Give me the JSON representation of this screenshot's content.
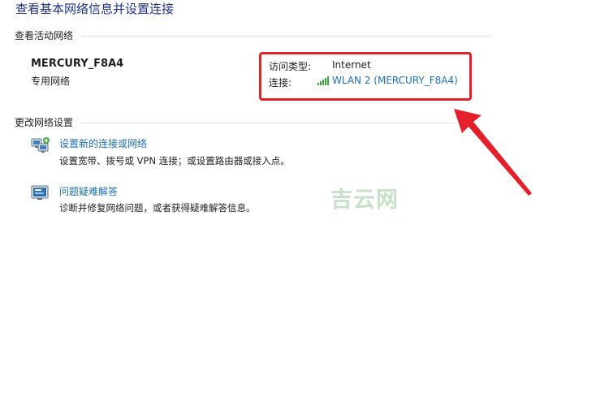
{
  "page": {
    "title": "查看基本网络信息并设置连接"
  },
  "active_networks": {
    "header": "查看活动网络",
    "network_name": "MERCURY_F8A4",
    "network_type": "专用网络",
    "access_type_label": "访问类型:",
    "access_type_value": "Internet",
    "connection_label": "连接:",
    "connection_value": "WLAN 2 (MERCURY_F8A4)",
    "connection_icon": "wifi-signal-icon"
  },
  "change_settings": {
    "header": "更改网络设置",
    "items": [
      {
        "icon": "new-connection-icon",
        "link": "设置新的连接或网络",
        "description": "设置宽带、拨号或 VPN 连接；或设置路由器或接入点。"
      },
      {
        "icon": "troubleshoot-icon",
        "link": "问题疑难解答",
        "description": "诊断并修复网络问题，或者获得疑难解答信息。"
      }
    ]
  },
  "watermark": "吉云网",
  "colors": {
    "title": "#1e3287",
    "link": "#1a6fb4",
    "highlight": "#e4202a",
    "signal": "#3aa33a",
    "watermark": "#c7e1c7"
  }
}
